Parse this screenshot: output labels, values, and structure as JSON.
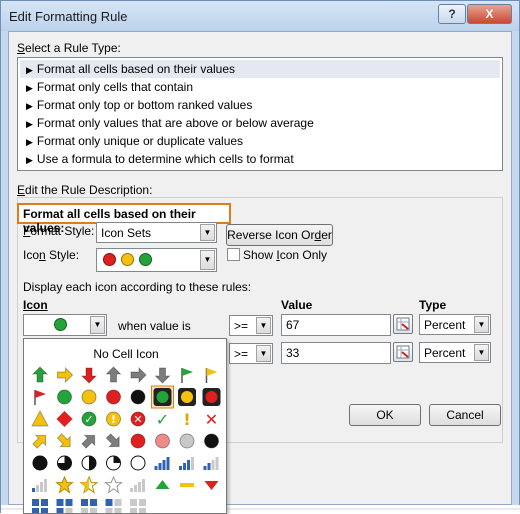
{
  "window": {
    "title": "Edit Formatting Rule",
    "help_label": "?",
    "close_label": "X"
  },
  "rule_type": {
    "label_prefix": "S",
    "label_rest": "elect a Rule Type:",
    "items": [
      "Format all cells based on their values",
      "Format only cells that contain",
      "Format only top or bottom ranked values",
      "Format only values that are above or below average",
      "Format only unique or duplicate values",
      "Use a formula to determine which cells to format"
    ],
    "selected_index": 0
  },
  "description": {
    "label_prefix": "E",
    "label_rest": "dit the Rule Description:",
    "heading": "Format all cells based on their values:",
    "format_style_label_a": "F",
    "format_style_label_b": "ormat Style:",
    "format_style_value": "Icon Sets",
    "reverse_a": "Reverse Icon Or",
    "reverse_u": "d",
    "reverse_b": "er",
    "icon_style_label_a": "Ico",
    "icon_style_label_u": "n",
    "icon_style_label_b": " Style:",
    "show_icon_a": "Show ",
    "show_icon_u": "I",
    "show_icon_b": "con Only",
    "display_rules": "Display each icon according to these rules:",
    "col_icon": "Icon",
    "col_value": "Value",
    "col_type": "Type",
    "when_value_is": "when value is",
    "rows": [
      {
        "op": ">=",
        "value": "67",
        "type": "Percent"
      },
      {
        "op": ">=",
        "value": "33",
        "type": "Percent"
      }
    ]
  },
  "buttons": {
    "ok": "OK",
    "cancel": "Cancel"
  },
  "icon_picker": {
    "no_cell_icon": "No Cell Icon",
    "selected_row": 1,
    "selected_col": 5
  },
  "colors": {
    "accent_orange": "#e07b1d",
    "red": "#e02020",
    "yellow": "#f4c20d",
    "green": "#23a33a",
    "gray": "#7d7d7d",
    "black": "#111111"
  }
}
